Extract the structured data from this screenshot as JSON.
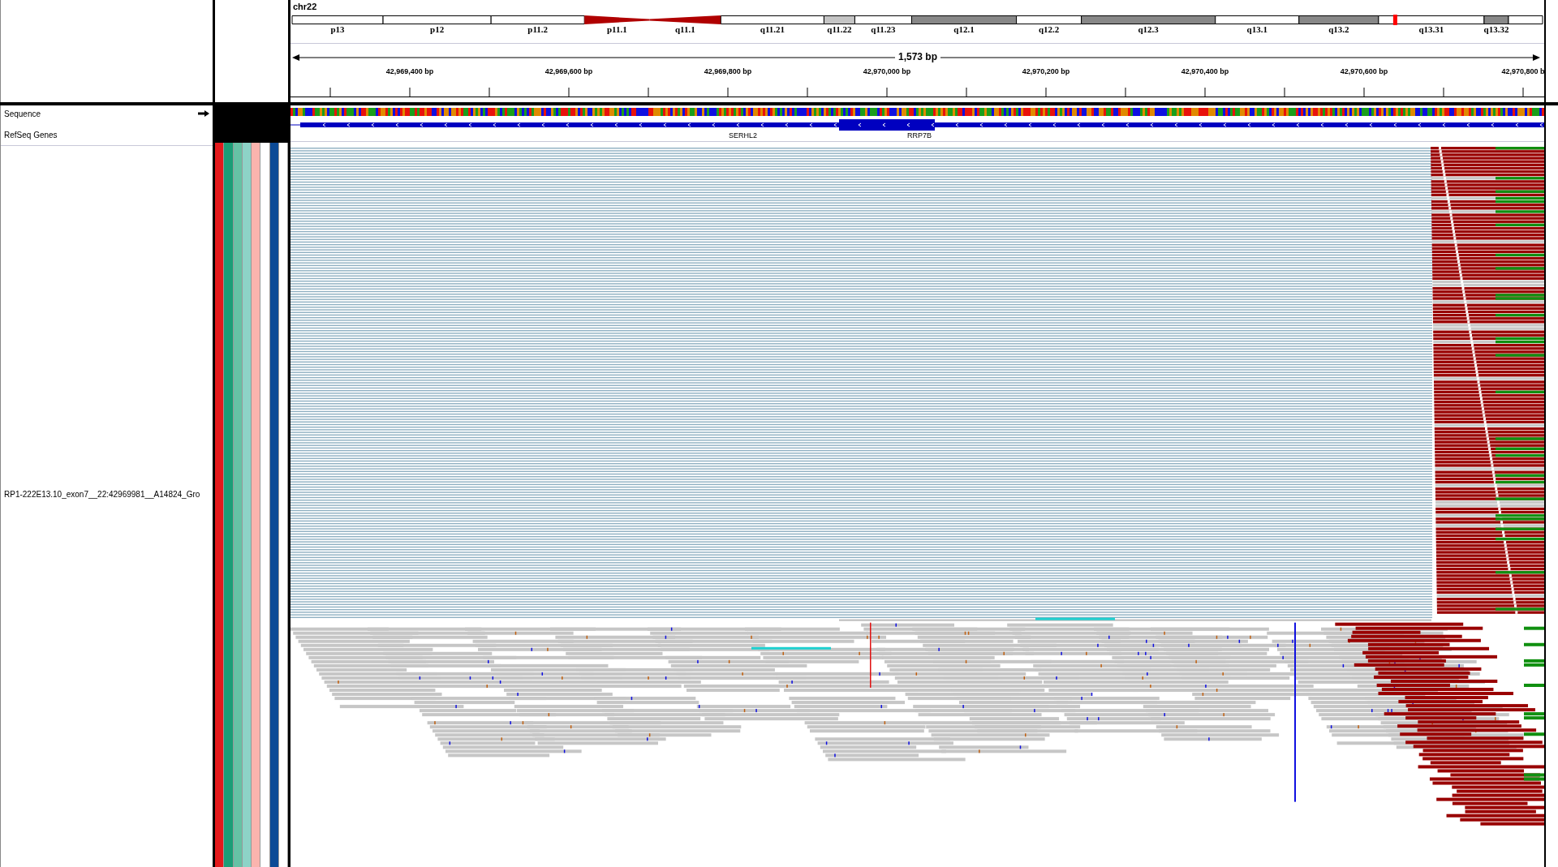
{
  "chromosome": "chr22",
  "cytobands": [
    {
      "label": "p13",
      "kind": "gneg"
    },
    {
      "label": "p12",
      "kind": "gneg"
    },
    {
      "label": "p11.2",
      "kind": "gneg"
    },
    {
      "label": "p11.1",
      "kind": "acenp"
    },
    {
      "label": "q11.1",
      "kind": "acenq"
    },
    {
      "label": "q11.21",
      "kind": "gneg"
    },
    {
      "label": "q11.22",
      "kind": "gpos25"
    },
    {
      "label": "q11.23",
      "kind": "gneg"
    },
    {
      "label": "q12.1",
      "kind": "gpos50"
    },
    {
      "label": "q12.2",
      "kind": "gneg"
    },
    {
      "label": "q12.3",
      "kind": "gpos50"
    },
    {
      "label": "q13.1",
      "kind": "gneg"
    },
    {
      "label": "q13.2",
      "kind": "gpos50"
    },
    {
      "label": "q13.31",
      "kind": "gneg"
    },
    {
      "label": "q13.32",
      "kind": "gpos50"
    },
    {
      "kind": "gneg"
    }
  ],
  "span": "1,573 bp",
  "ticks": [
    "42,969,400 bp",
    "42,969,600 bp",
    "42,969,800 bp",
    "42,970,000 bp",
    "42,970,200 bp",
    "42,970,400 bp",
    "42,970,600 bp",
    "42,970,800 b"
  ],
  "tracks": [
    {
      "name": "Sequence",
      "kind": "sequence"
    },
    {
      "name": "RefSeq Genes",
      "kind": "genes",
      "genes": [
        "SERHL2",
        "RRP7B"
      ]
    }
  ],
  "alignment_track": {
    "name": "RP1-222E13.10_exon7__22:42969981__A14824_Gro"
  },
  "attributes": [
    {
      "color": "#e41a1c"
    },
    {
      "color": "#1b9e77"
    },
    {
      "color": "#66c2a5"
    },
    {
      "color": "#8dd3c7"
    },
    {
      "color": "#fbb4ae"
    },
    {
      "color": "#ffffff"
    },
    {
      "color": "#0b4a96"
    },
    {
      "color": "#ffffff"
    }
  ]
}
